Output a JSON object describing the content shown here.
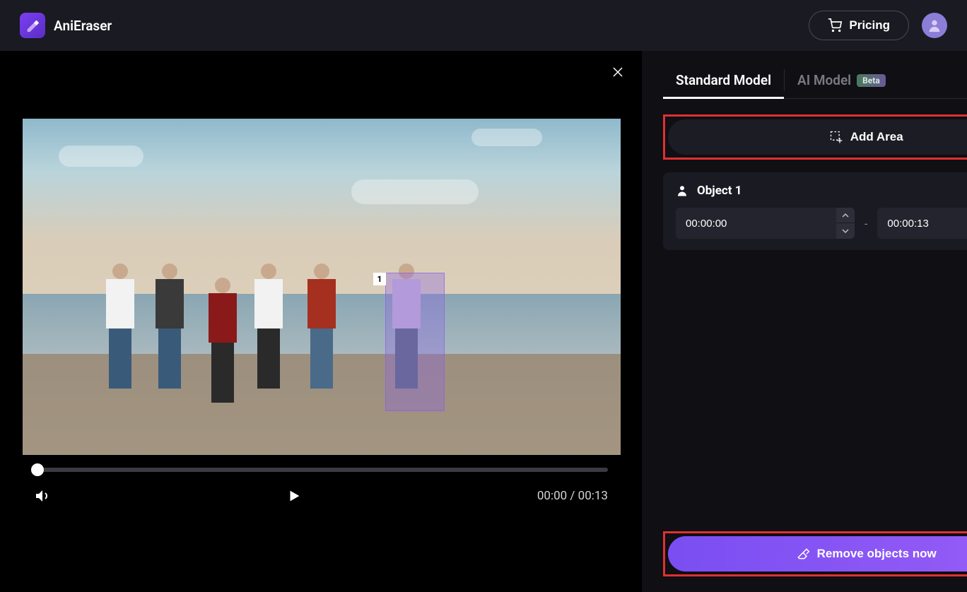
{
  "brand": {
    "name": "AniEraser"
  },
  "header": {
    "pricing_label": "Pricing"
  },
  "video": {
    "current_time": "00:00",
    "total_time": "00:13",
    "time_display": "00:00 / 00:13",
    "selection_label": "1"
  },
  "tabs": {
    "standard": "Standard Model",
    "ai": "AI Model",
    "beta_badge": "Beta"
  },
  "sidebar": {
    "add_area_label": "Add Area",
    "object": {
      "title": "Object 1",
      "start_time": "00:00:00",
      "end_time": "00:00:13"
    },
    "remove_label": "Remove objects now"
  }
}
